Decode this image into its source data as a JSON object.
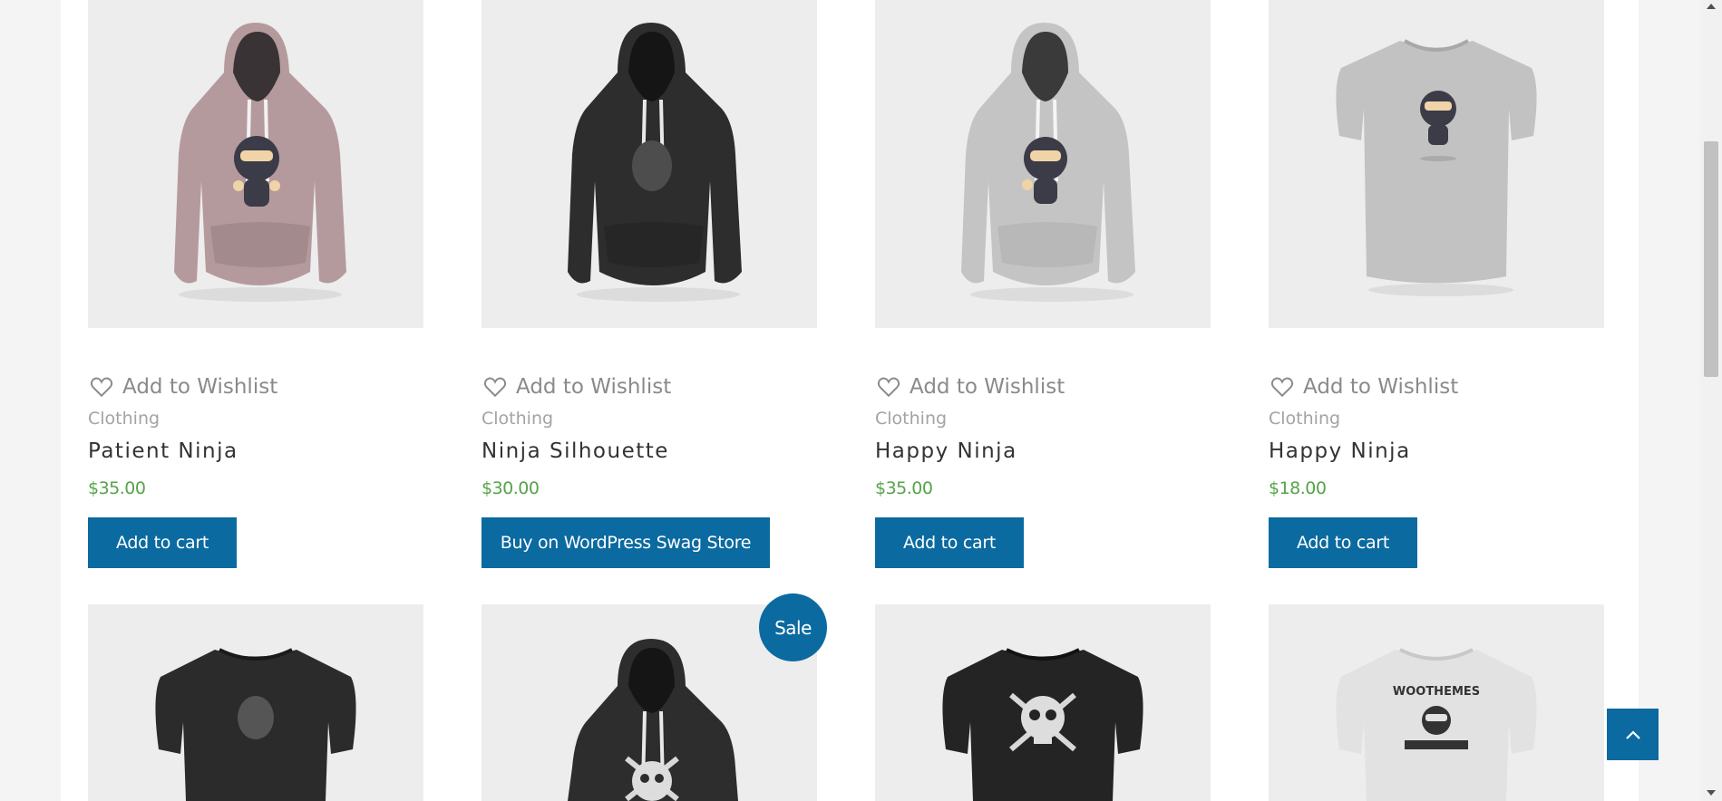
{
  "colors": {
    "accent": "#0b6aa0",
    "price": "#56a34a",
    "meta": "#a3a3a3"
  },
  "wishlist_label": "Add to Wishlist",
  "products": [
    {
      "category": "Clothing",
      "name": "Patient Ninja",
      "price": "$35.00",
      "button": "Add to cart",
      "image": "pink-hoodie-ninja-image"
    },
    {
      "category": "Clothing",
      "name": "Ninja Silhouette",
      "price": "$30.00",
      "button": "Buy on WordPress Swag Store",
      "image": "black-hoodie-silhouette-image"
    },
    {
      "category": "Clothing",
      "name": "Happy Ninja",
      "price": "$35.00",
      "button": "Add to cart",
      "image": "grey-hoodie-ninja-image"
    },
    {
      "category": "Clothing",
      "name": "Happy Ninja",
      "price": "$18.00",
      "button": "Add to cart",
      "image": "grey-tshirt-ninja-image"
    }
  ],
  "second_row": [
    {
      "image": "black-tshirt-silhouette-image"
    },
    {
      "image": "black-hoodie-skull-image",
      "badge": "Sale"
    },
    {
      "image": "black-tshirt-skull-image"
    },
    {
      "image": "white-tshirt-woothemes-image"
    }
  ],
  "tshirt_prints": {
    "woothemes_text": "WOOTHEMES"
  },
  "back_to_top_icon": "chevron-up-icon"
}
